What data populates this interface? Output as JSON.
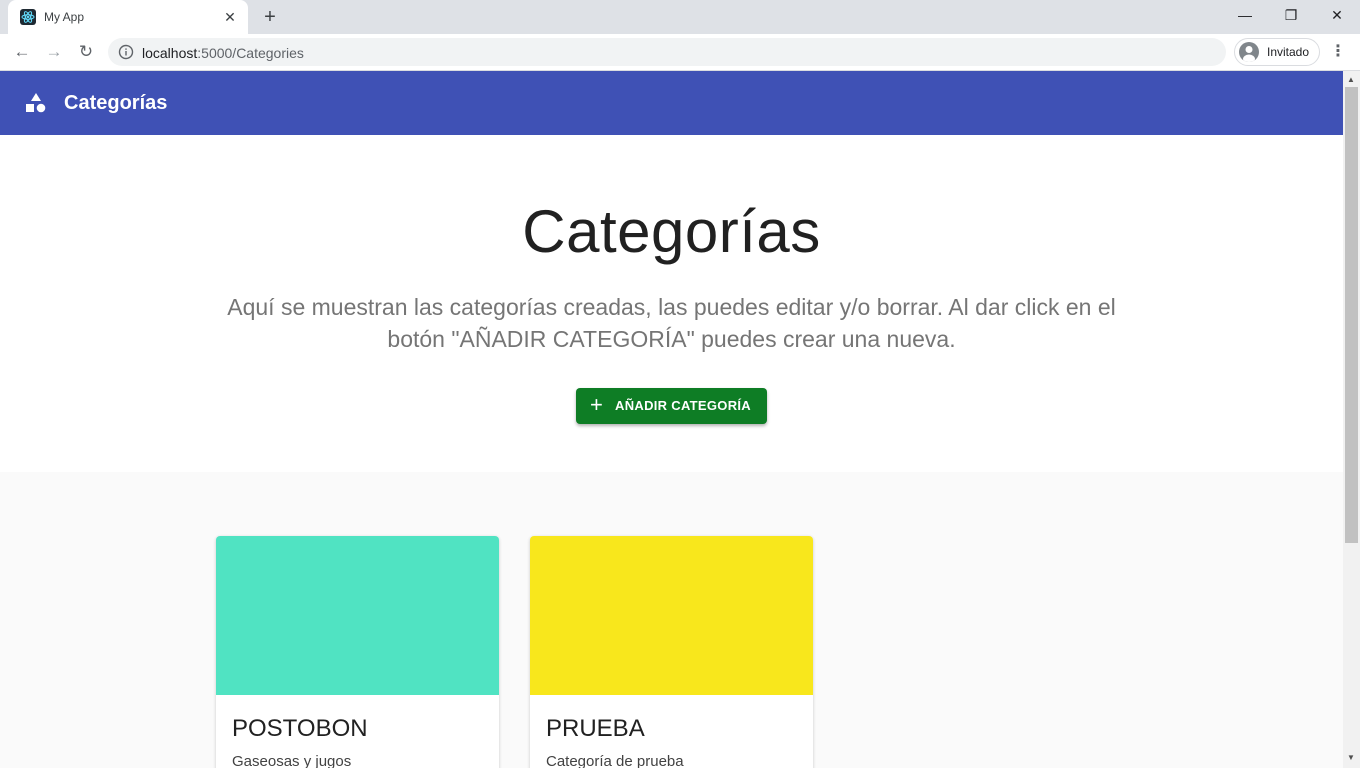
{
  "browser": {
    "tab_title": "My App",
    "tab_close": "✕",
    "new_tab": "+",
    "minimize": "—",
    "restore": "❐",
    "close": "✕",
    "back": "←",
    "forward": "→",
    "reload": "↻",
    "url_host": "localhost",
    "url_path": ":5000/Categories",
    "profile_label": "Invitado",
    "menu": "⋮"
  },
  "appbar": {
    "title": "Categorías",
    "icon": "category-shapes-icon",
    "color": "#3f51b5"
  },
  "hero": {
    "title": "Categorías",
    "description": "Aquí se muestran las categorías creadas, las puedes editar y/o borrar. Al dar click en el botón \"AÑADIR CATEGORÍA\" puedes crear una nueva.",
    "add_button_icon": "+",
    "add_button_label": "AÑADIR CATEGORÍA",
    "add_button_color": "#0e7d25"
  },
  "categories": [
    {
      "name": "POSTOBON",
      "description": "Gaseosas y jugos",
      "color": "#50e3c2"
    },
    {
      "name": "PRUEBA",
      "description": "Categoría de prueba",
      "color": "#f8e71c"
    }
  ]
}
